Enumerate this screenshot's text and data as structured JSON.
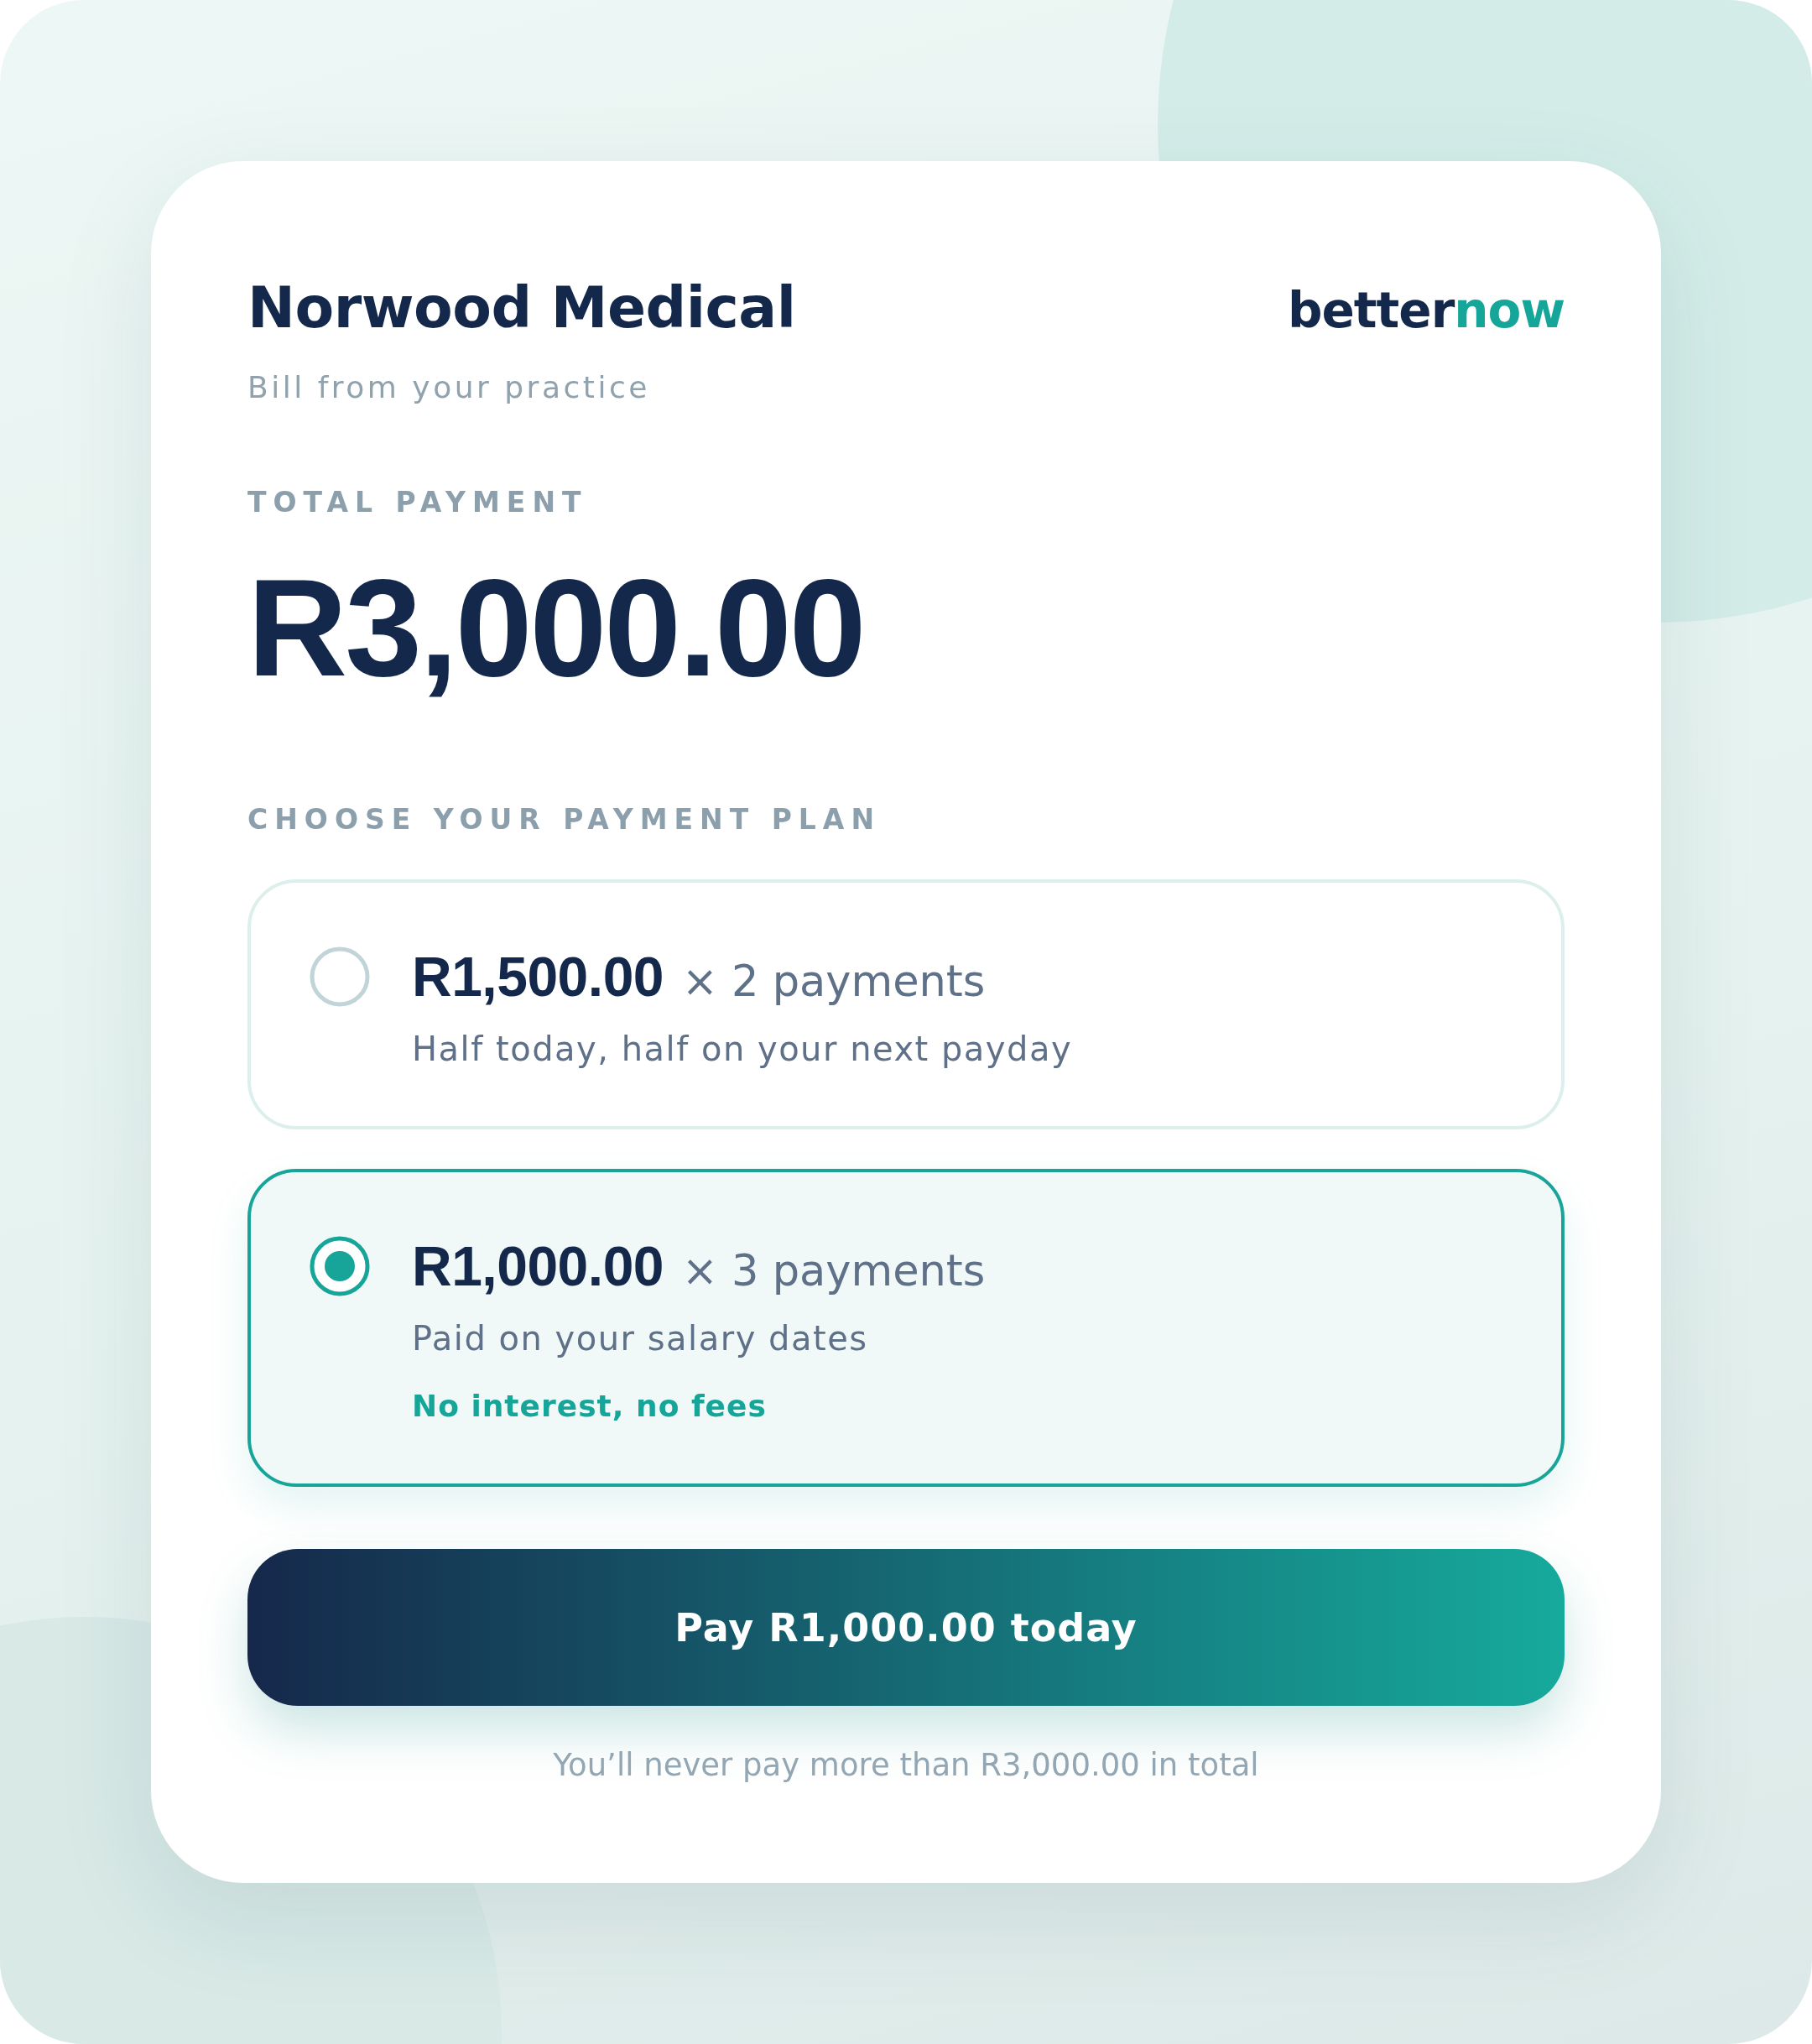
{
  "merchant": {
    "name": "Norwood Medical",
    "subtitle": "Bill from your practice"
  },
  "logo": [
    {
      "text": "better",
      "kind": "plain"
    },
    {
      "text": "now",
      "kind": "accent"
    }
  ],
  "total": {
    "label": "TOTAL PAYMENT",
    "amount": "R3,000.00"
  },
  "plans": {
    "heading": "CHOOSE YOUR PAYMENT PLAN",
    "options": [
      {
        "amount": "R1,500.00",
        "count": "× 2 payments",
        "description": "Half today, half on your next payday",
        "selected": false
      },
      {
        "amount": "R1,000.00",
        "count": "× 3 payments",
        "description": "Paid on your salary dates",
        "note": "No interest, no fees",
        "selected": true
      }
    ]
  },
  "pay_button": {
    "label": "Pay R1,000.00 today"
  },
  "footnote": "You’ll never pay more than R3,000.00 in total"
}
